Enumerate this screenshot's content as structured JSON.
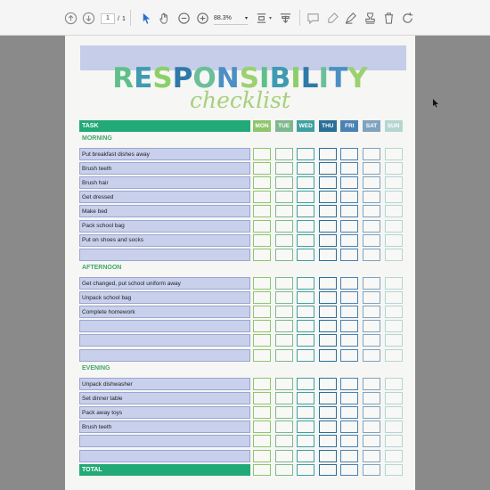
{
  "toolbar": {
    "page_current": "1",
    "page_separator": "/",
    "page_total": "1",
    "zoom": "88.3%",
    "icons": [
      "page-up-icon",
      "page-down-icon",
      "select-arrow-icon",
      "hand-tool-icon",
      "zoom-out-icon",
      "zoom-in-icon",
      "fit-page-icon",
      "scroll-mode-icon",
      "comment-icon",
      "highlight-icon",
      "draw-icon",
      "stamp-icon",
      "delete-icon",
      "rotate-icon"
    ]
  },
  "document": {
    "title": "RESPONSIBILITY",
    "subtitle": "checklist",
    "task_header": "TASK",
    "days": [
      "MON",
      "TUE",
      "WED",
      "THU",
      "FRI",
      "SAT",
      "SUN"
    ],
    "day_colors": [
      "#8ec66b",
      "#7eb88f",
      "#3fa0a0",
      "#2a6f98",
      "#4a82b4",
      "#7fa3bf",
      "#b4d6d2"
    ],
    "total_label": "TOTAL",
    "sections": [
      {
        "label": "MORNING",
        "tasks": [
          "Put breakfast dishes away",
          "Brush teeth",
          "Brush hair",
          "Get dressed",
          "Make bed",
          "Pack school bag",
          "Put on shoes and socks",
          ""
        ]
      },
      {
        "label": "AFTERNOON",
        "tasks": [
          "Get changed, put school uniform away",
          "Unpack school bag",
          "Complete homework",
          "",
          "",
          ""
        ]
      },
      {
        "label": "EVENING",
        "tasks": [
          "Unpack dishwasher",
          "Set dinner table",
          "Pack away toys",
          "Brush teeth",
          "",
          ""
        ]
      }
    ]
  }
}
